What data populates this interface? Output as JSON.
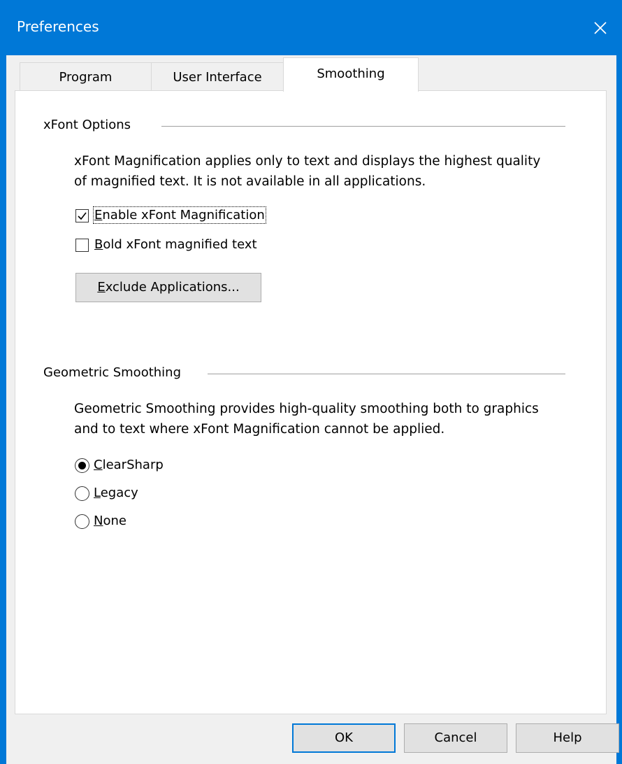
{
  "window": {
    "title": "Preferences"
  },
  "tabs": [
    {
      "label": "Program",
      "active": false
    },
    {
      "label": "User Interface",
      "active": false
    },
    {
      "label": "Smoothing",
      "active": true
    }
  ],
  "xfont": {
    "group_label": "xFont Options",
    "description_line1": "xFont Magnification applies only to text and displays the highest quality",
    "description_line2": "of magnified text. It is not available in all applications.",
    "enable_checkbox": {
      "accel": "E",
      "label_rest": "nable xFont Magnification",
      "checked": true
    },
    "bold_checkbox": {
      "accel": "B",
      "label_rest": "old xFont magnified text",
      "checked": false
    },
    "exclude_button": {
      "accel": "E",
      "label_rest": "xclude Applications..."
    }
  },
  "geometric": {
    "group_label": "Geometric Smoothing",
    "description_line1": "Geometric Smoothing provides high-quality smoothing both to graphics",
    "description_line2": "and to text where xFont Magnification cannot be applied.",
    "options": [
      {
        "accel": "C",
        "label_rest": "learSharp",
        "selected": true
      },
      {
        "accel": "L",
        "label_rest": "egacy",
        "selected": false
      },
      {
        "accel": "N",
        "label_rest": "one",
        "selected": false
      }
    ]
  },
  "footer": {
    "ok_label": "OK",
    "cancel_label": "Cancel",
    "help_label": "Help"
  },
  "colors": {
    "titlebar": "#0078d7",
    "accent": "#0078d7"
  },
  "icons": {
    "close": "close-icon",
    "checkmark": "checkmark-icon"
  }
}
